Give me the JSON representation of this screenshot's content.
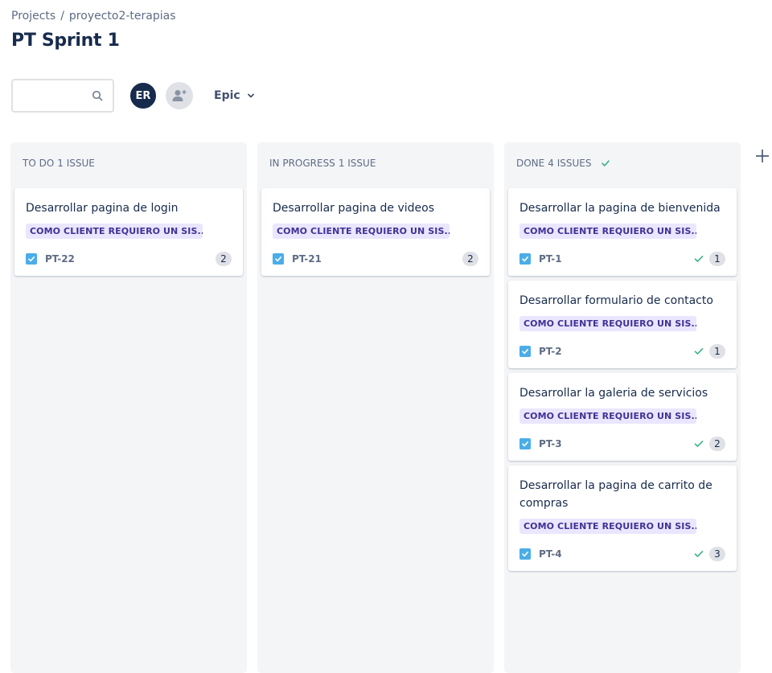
{
  "breadcrumb": {
    "projects": "Projects",
    "separator": "/",
    "project": "proyecto2-terapias"
  },
  "page": {
    "title": "PT Sprint 1"
  },
  "toolbar": {
    "search_placeholder": "",
    "avatar_initials": "ER",
    "epic_label": "Epic"
  },
  "icons": {
    "search": "search-icon",
    "add_people": "add-people-icon",
    "chevron": "chevron-down-icon",
    "check": "check-icon",
    "plus": "plus-icon",
    "task": "task-icon"
  },
  "colors": {
    "epic_bg": "#eae6ff",
    "epic_text": "#403294",
    "task_icon": "#4bade8",
    "done_green": "#36b37e",
    "column_bg": "#f4f5f7"
  },
  "columns": [
    {
      "name": "To Do",
      "count_label": "1 issue",
      "cards": [
        {
          "title": "Desarrollar pagina de login",
          "epic": "COMO CLIENTE REQUIERO UN SIS...",
          "key": "PT-22",
          "points": "2"
        }
      ]
    },
    {
      "name": "In Progress",
      "count_label": "1 issue",
      "cards": [
        {
          "title": "Desarrollar pagina de videos",
          "epic": "COMO CLIENTE REQUIERO UN SIS...",
          "key": "PT-21",
          "points": "2"
        }
      ]
    },
    {
      "name": "Done",
      "count_label": "4 issues",
      "cards": [
        {
          "title": "Desarrollar la pagina de bienvenida",
          "epic": "COMO CLIENTE REQUIERO UN SIS...",
          "key": "PT-1",
          "points": "1"
        },
        {
          "title": "Desarrollar formulario de contacto",
          "epic": "COMO CLIENTE REQUIERO UN SIS...",
          "key": "PT-2",
          "points": "1"
        },
        {
          "title": "Desarrollar la galeria de servicios",
          "epic": "COMO CLIENTE REQUIERO UN SIS...",
          "key": "PT-3",
          "points": "2"
        },
        {
          "title": "Desarrollar la pagina de carrito de compras",
          "epic": "COMO CLIENTE REQUIERO UN SIS...",
          "key": "PT-4",
          "points": "3"
        }
      ]
    }
  ]
}
